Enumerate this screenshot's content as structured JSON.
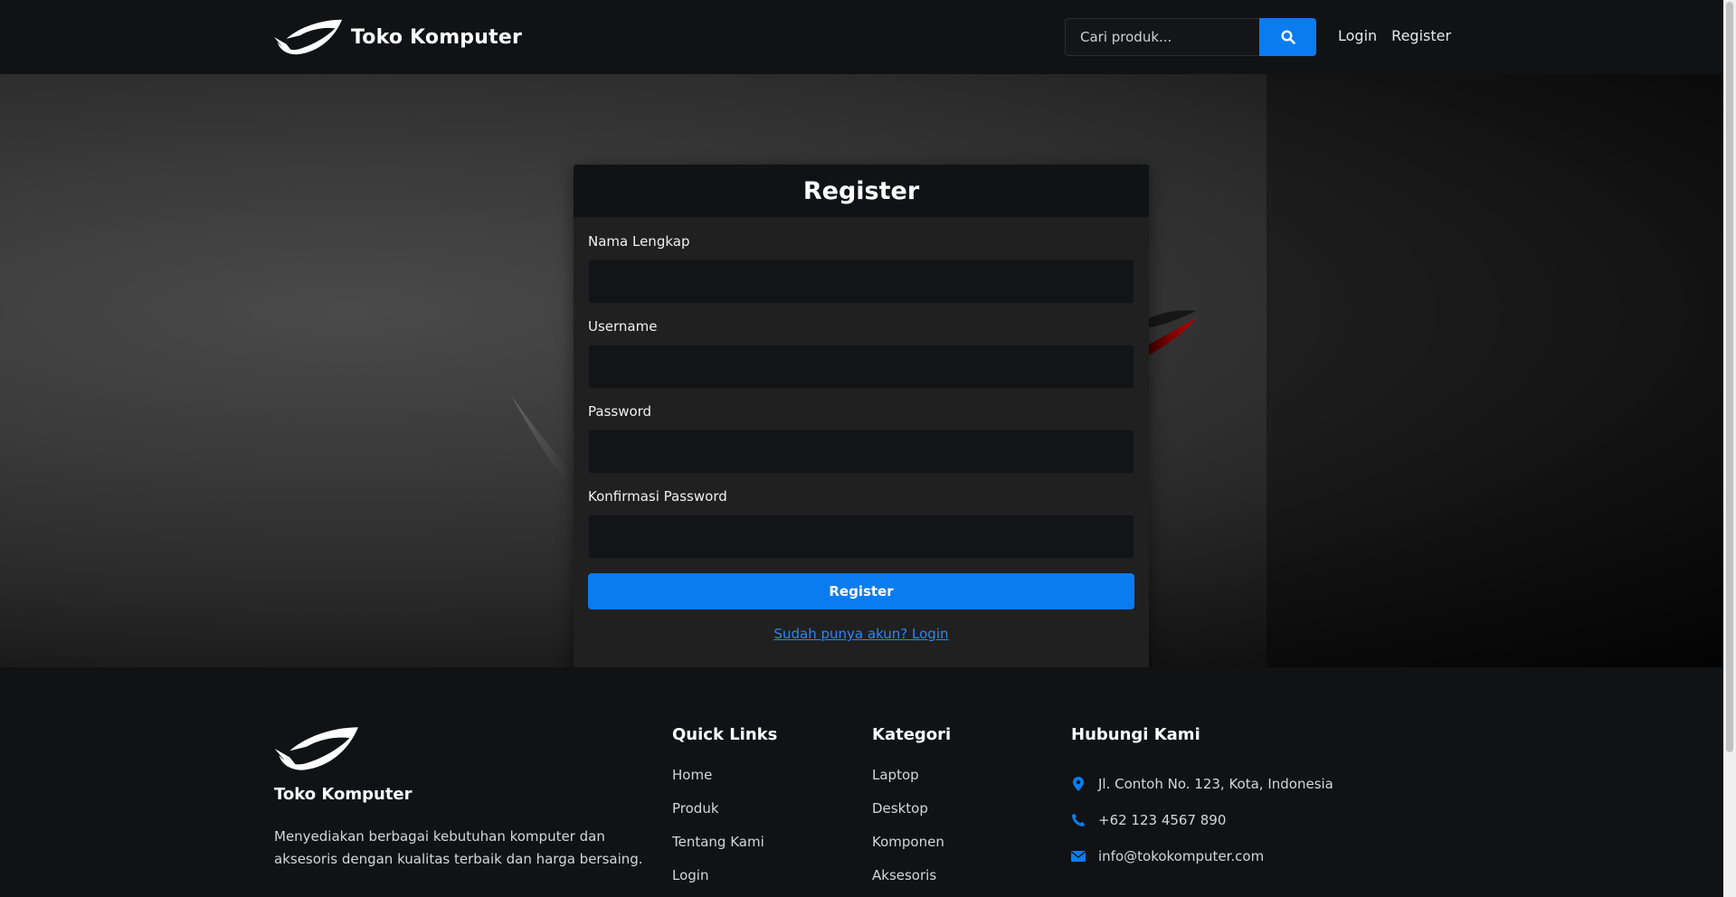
{
  "header": {
    "brand": "Toko Komputer",
    "search_placeholder": "Cari produk...",
    "login": "Login",
    "register": "Register"
  },
  "form": {
    "title": "Register",
    "fields": [
      {
        "label": "Nama Lengkap",
        "value": ""
      },
      {
        "label": "Username",
        "value": ""
      },
      {
        "label": "Password",
        "value": ""
      },
      {
        "label": "Konfirmasi Password",
        "value": ""
      }
    ],
    "submit": "Register",
    "login_link": "Sudah punya akun? Login"
  },
  "footer": {
    "brand": "Toko Komputer",
    "description": "Menyediakan berbagai kebutuhan komputer dan aksesoris dengan kualitas terbaik dan harga bersaing.",
    "quick_links": {
      "title": "Quick Links",
      "items": [
        "Home",
        "Produk",
        "Tentang Kami",
        "Login"
      ]
    },
    "kategori": {
      "title": "Kategori",
      "items": [
        "Laptop",
        "Desktop",
        "Komponen",
        "Aksesoris"
      ]
    },
    "contact": {
      "title": "Hubungi Kami",
      "address": "Jl. Contoh No. 123, Kota, Indonesia",
      "phone": "+62 123 4567 890",
      "email": "info@tokokomputer.com"
    }
  },
  "colors": {
    "accent": "#0b7cf0",
    "dark_bg": "#111214",
    "panel_bg": "#202020"
  }
}
